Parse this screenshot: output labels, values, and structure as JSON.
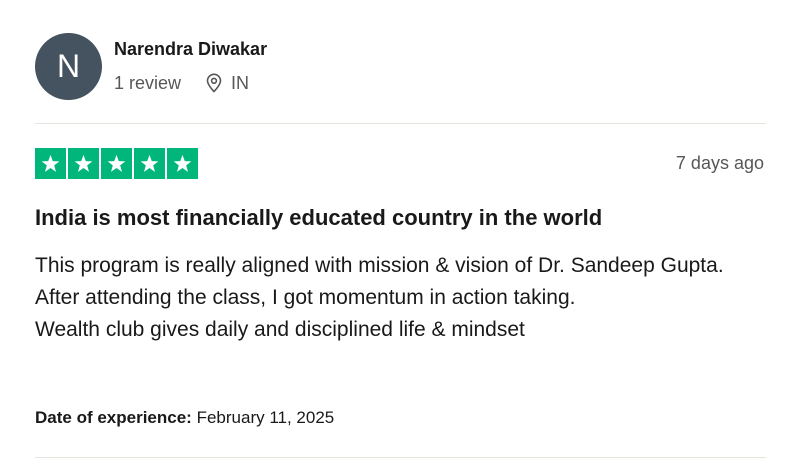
{
  "reviewer": {
    "avatar_initial": "N",
    "avatar_color": "#44535f",
    "name": "Narendra Diwakar",
    "review_count": "1 review",
    "location_icon": "location-pin-icon",
    "country": "IN"
  },
  "review": {
    "rating": 5,
    "rating_max": 5,
    "star_color": "#00b67a",
    "date": "7 days ago",
    "title": "India is most financially educated country in the world",
    "body_lines": [
      "This program is really aligned with mission & vision of Dr. Sandeep Gupta.",
      "After attending the class, I got momentum in action taking.",
      "Wealth club gives daily and disciplined life & mindset"
    ],
    "experience_label": "Date of experience:",
    "experience_date": "February 11, 2025"
  }
}
